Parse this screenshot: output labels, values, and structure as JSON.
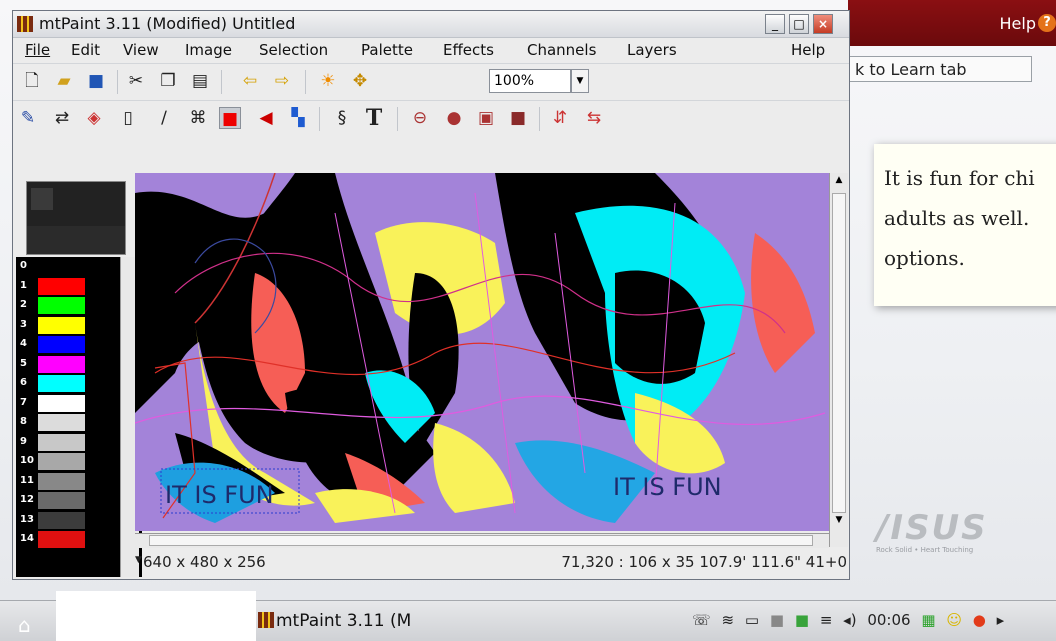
{
  "window": {
    "title": "mtPaint 3.11 (Modified) Untitled",
    "minimize": "_",
    "maximize": "□",
    "close": "×"
  },
  "menus": [
    "File",
    "Edit",
    "View",
    "Image",
    "Selection",
    "Palette",
    "Effects",
    "Channels",
    "Layers",
    "Help"
  ],
  "toolbar1": {
    "icons": [
      "new-icon",
      "open-icon",
      "save-icon",
      "cut-icon",
      "copy-icon",
      "paste-icon",
      "undo-icon",
      "redo-icon",
      "transform-color-icon",
      "pan-icon"
    ],
    "zoom": "100%"
  },
  "toolbar2": {
    "icons": [
      "paint-icon",
      "shuffle-icon",
      "flood-fill-icon",
      "straight-line-icon",
      "smudge-icon",
      "clone-icon",
      "select-rectangle-icon",
      "select-polygon-icon",
      "gradient-icon",
      "lasso-icon",
      "text-icon",
      "ellipse-outline-icon",
      "ellipse-filled-icon",
      "rectangle-outline-icon",
      "rectangle-filled-icon",
      "flip-vertical-icon",
      "flip-horizontal-icon"
    ],
    "text_label": "T"
  },
  "palette": {
    "entries": [
      {
        "index": "0",
        "color": "#000000"
      },
      {
        "index": "1",
        "color": "#ff0000"
      },
      {
        "index": "2",
        "color": "#00ff00"
      },
      {
        "index": "3",
        "color": "#ffff00"
      },
      {
        "index": "4",
        "color": "#0000ff"
      },
      {
        "index": "5",
        "color": "#ff00ff"
      },
      {
        "index": "6",
        "color": "#00ffff"
      },
      {
        "index": "7",
        "color": "#ffffff"
      },
      {
        "index": "8",
        "color": "#dcdcdc"
      },
      {
        "index": "9",
        "color": "#c8c8c8"
      },
      {
        "index": "10",
        "color": "#a8a8a8"
      },
      {
        "index": "11",
        "color": "#888888"
      },
      {
        "index": "12",
        "color": "#6a6a6a"
      },
      {
        "index": "13",
        "color": "#3c3c3c"
      },
      {
        "index": "14",
        "color": "#e01010"
      }
    ]
  },
  "canvas": {
    "text_left": "IT IS FUN",
    "text_right": "IT IS FUN"
  },
  "status": {
    "dims": "640 x 480 x 256",
    "coords": "71,320 : 106 x 35   107.9' 111.6\" 41+0"
  },
  "launcher": {
    "help": "Help",
    "help_icon": "?",
    "back_tab": "k to Learn tab",
    "info_lines": [
      "It is fun for chi",
      "adults as well.",
      "options."
    ],
    "brand": "/ISUS",
    "tagline": "Rock Solid • Heart Touching"
  },
  "taskbar": {
    "task": "mtPaint 3.11 (M",
    "clock": "00:06"
  }
}
